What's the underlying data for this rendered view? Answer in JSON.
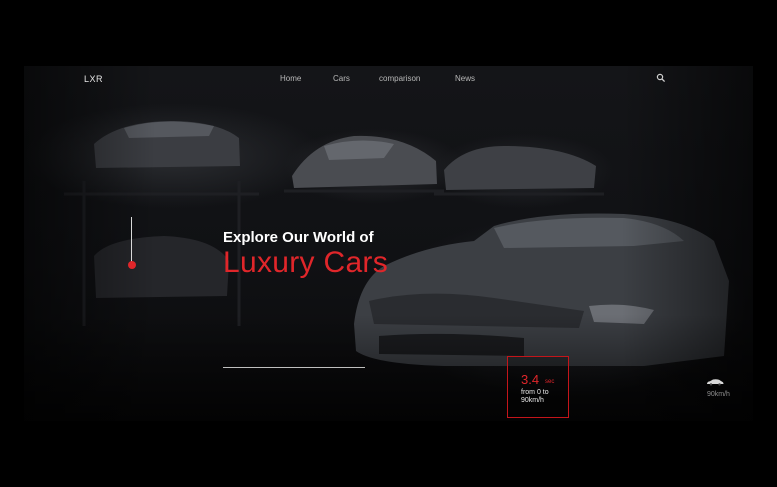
{
  "brand": {
    "logo": "LXR"
  },
  "nav": {
    "items": [
      {
        "label": "Home"
      },
      {
        "label": "Cars"
      },
      {
        "label": "comparison"
      },
      {
        "label": "News"
      }
    ]
  },
  "icons": {
    "search": "search-icon",
    "car": "car-icon"
  },
  "hero": {
    "title_line1": "Explore Our World of",
    "title_line2": "Luxury Cars"
  },
  "stat": {
    "value": "3.4",
    "unit": "sec",
    "label": "from 0 to 90km/h"
  },
  "mini_stat": {
    "label": "90km/h"
  },
  "colors": {
    "accent": "#e0262a",
    "background": "#000000",
    "text": "#ffffff",
    "nav_text": "#b8b8b8"
  }
}
